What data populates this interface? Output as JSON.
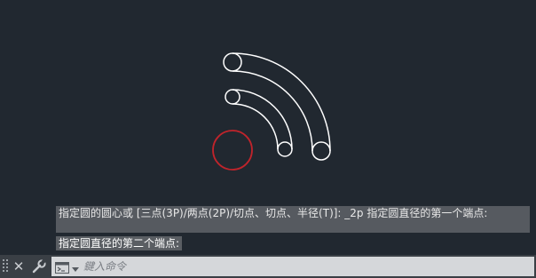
{
  "history": {
    "line1": "指定圆的圆心或 [三点(3P)/两点(2P)/切点、切点、半径(T)]: _2p 指定圆直径的第一个端点:",
    "line2": "指定圆直径的第二个端点:"
  },
  "command": {
    "placeholder": "鍵入命令"
  },
  "icons": {
    "close": "close-icon",
    "settings": "wrench-icon",
    "prompt": "command-prompt-icon",
    "dropdown": "dropdown-arrow-icon"
  },
  "colors": {
    "background": "#212830",
    "geometry": "#ffffff",
    "preview_circle": "#c0242b"
  }
}
